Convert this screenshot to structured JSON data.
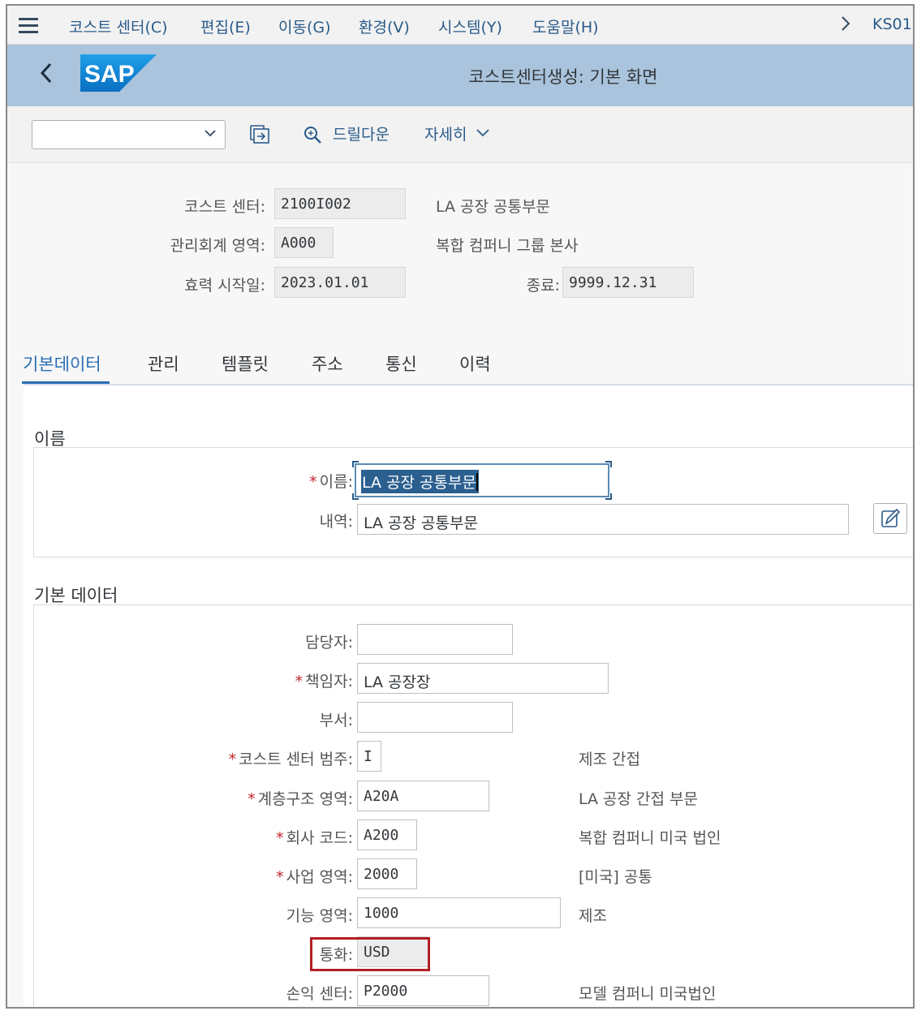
{
  "menu": {
    "items": [
      {
        "label": "코스트 센터(C)"
      },
      {
        "label": "편집(E)"
      },
      {
        "label": "이동(G)"
      },
      {
        "label": "환경(V)"
      },
      {
        "label": "시스템(Y)"
      },
      {
        "label": "도움말(H)"
      }
    ],
    "tcode": "KS01"
  },
  "shell": {
    "logo_text": "SAP",
    "title": "코스트센터생성: 기본 화면"
  },
  "toolbar": {
    "variant_value": "",
    "drilldown_label": "드릴다운",
    "more_label": "자세히"
  },
  "header": {
    "cost_center": {
      "label": "코스트 센터:",
      "value": "2100I002",
      "desc": "LA 공장 공통부문"
    },
    "controlling_area": {
      "label": "관리회계 영역:",
      "value": "A000",
      "desc": "복합 컴퍼니 그룹 본사"
    },
    "valid_from": {
      "label": "효력 시작일:",
      "value": "2023.01.01"
    },
    "valid_to": {
      "label": "종료:",
      "value": "9999.12.31"
    }
  },
  "tabs": [
    {
      "label": "기본데이터",
      "active": true
    },
    {
      "label": "관리"
    },
    {
      "label": "템플릿"
    },
    {
      "label": "주소"
    },
    {
      "label": "통신"
    },
    {
      "label": "이력"
    }
  ],
  "names_section": {
    "title": "이름",
    "name": {
      "label": "이름:",
      "value": "LA 공장 공통부문"
    },
    "description": {
      "label": "내역:",
      "value": "LA 공장 공통부문"
    }
  },
  "basic_section": {
    "title": "기본 데이터",
    "person_responsible_user": {
      "label": "담당자:",
      "value": ""
    },
    "person_responsible": {
      "label": "책임자:",
      "value": "LA 공장장"
    },
    "department": {
      "label": "부서:",
      "value": ""
    },
    "category": {
      "label": "코스트 센터 범주:",
      "value": "I",
      "desc": "제조 간접"
    },
    "hierarchy_area": {
      "label": "계층구조 영역:",
      "value": "A20A",
      "desc": "LA 공장 간접 부문"
    },
    "company_code": {
      "label": "회사 코드:",
      "value": "A200",
      "desc": "복합 컴퍼니 미국 법인"
    },
    "business_area": {
      "label": "사업 영역:",
      "value": "2000",
      "desc": "[미국] 공통"
    },
    "functional_area": {
      "label": "기능 영역:",
      "value": "1000",
      "desc": "제조"
    },
    "currency": {
      "label": "통화:",
      "value": "USD"
    },
    "profit_center": {
      "label": "손익 센터:",
      "value": "P2000",
      "desc": "모델 컴퍼니 미국법인"
    }
  },
  "colors": {
    "shell_bg": "#a9c4dc",
    "link_blue": "#2a5b8b",
    "required_red": "#c0262d",
    "highlight_red": "#b21f24",
    "active_tab": "#2a6db5"
  }
}
